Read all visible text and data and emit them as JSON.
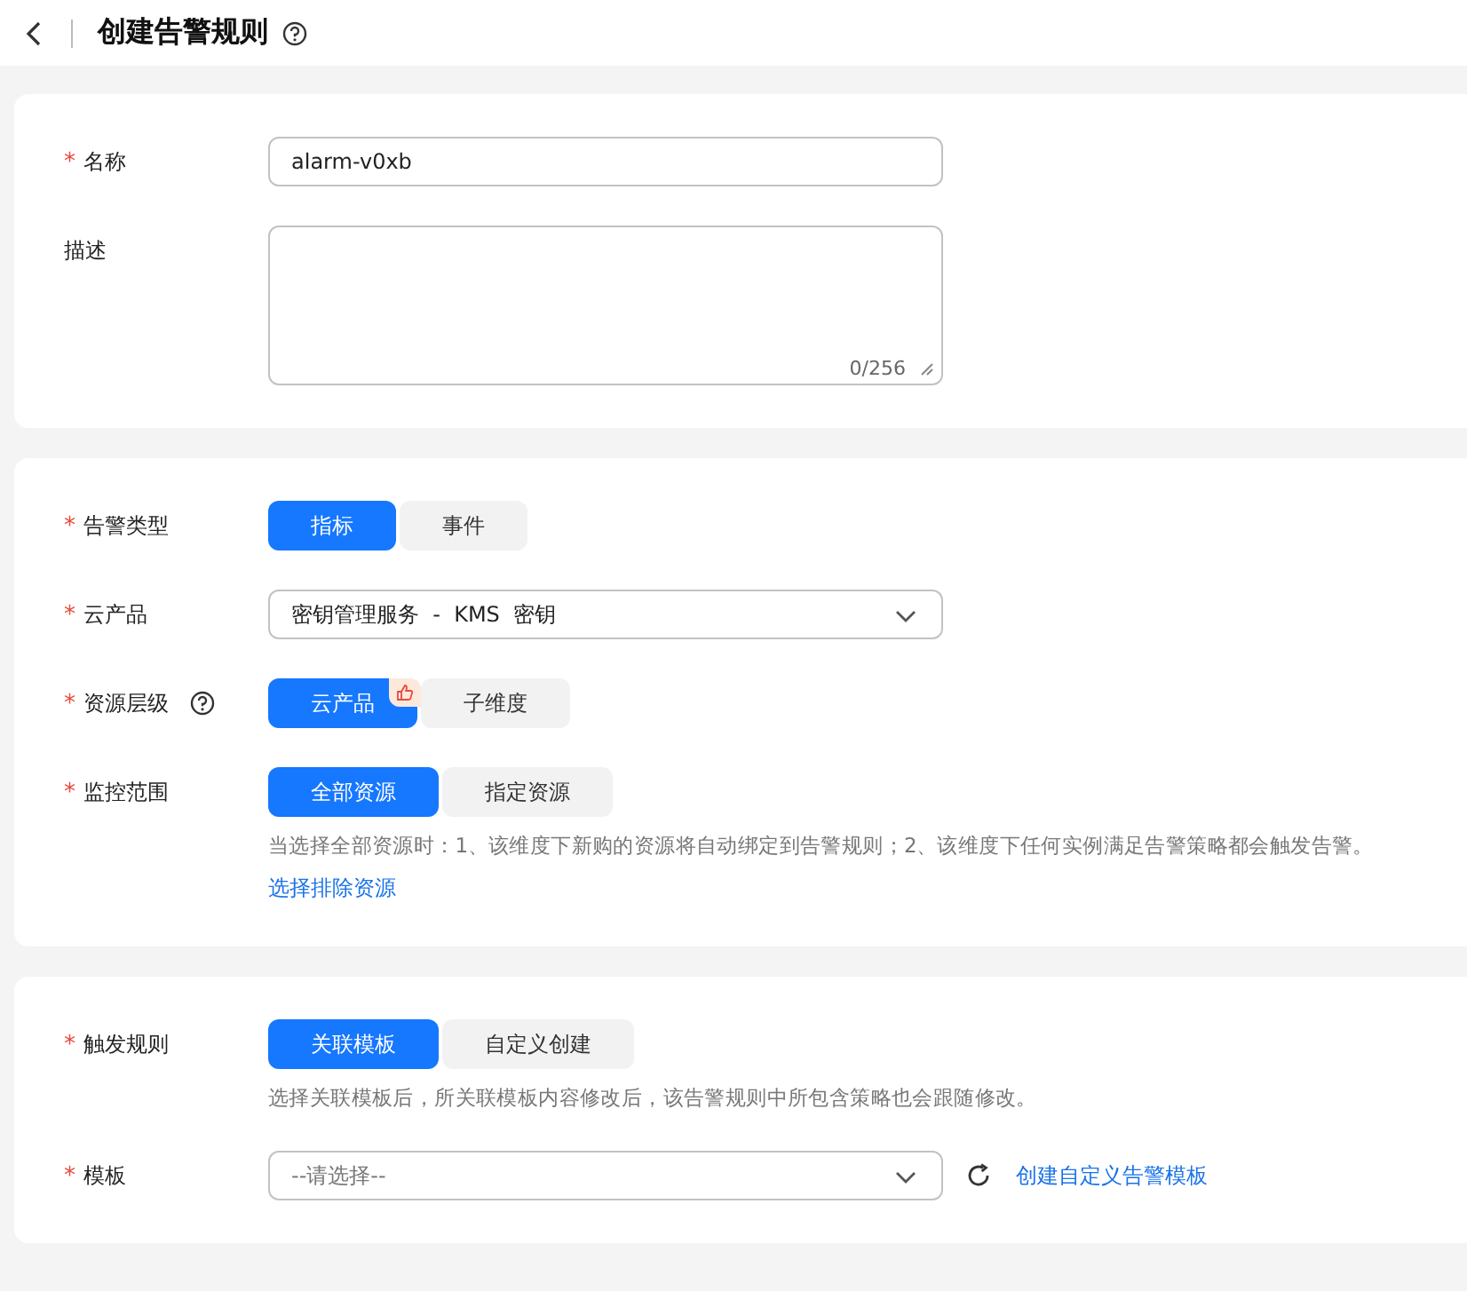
{
  "header": {
    "title": "创建告警规则",
    "help": true
  },
  "sections": [
    {
      "fields": [
        {
          "kind": "text",
          "label": "名称",
          "required_mark": "*",
          "value": "alarm-v0xb"
        },
        {
          "kind": "textarea",
          "label": "描述",
          "counter": "0/256"
        }
      ]
    },
    {
      "fields": [
        {
          "kind": "segmented",
          "label": "告警类型",
          "required_mark": "*",
          "options": [
            {
              "label": "指标",
              "selected": true
            },
            {
              "label": "事件",
              "selected": false
            }
          ]
        },
        {
          "kind": "select",
          "label": "云产品",
          "required_mark": "*",
          "value": "密钥管理服务  -  KMS  密钥"
        },
        {
          "kind": "segmented",
          "label": "资源层级",
          "required_mark": "*",
          "help": true,
          "options": [
            {
              "label": "云产品",
              "selected": true,
              "badge": true
            },
            {
              "label": "子维度",
              "selected": false
            }
          ]
        },
        {
          "kind": "segmented",
          "label": "监控范围",
          "required_mark": "*",
          "options": [
            {
              "label": "全部资源",
              "selected": true
            },
            {
              "label": "指定资源",
              "selected": false
            }
          ],
          "hint": "当选择全部资源时：1、该维度下新购的资源将自动绑定到告警规则；2、该维度下任何实例满足告警策略都会触发告警。",
          "link": "选择排除资源"
        }
      ]
    },
    {
      "fields": [
        {
          "kind": "segmented",
          "label": "触发规则",
          "required_mark": "*",
          "options": [
            {
              "label": "关联模板",
              "selected": true
            },
            {
              "label": "自定义创建",
              "selected": false
            }
          ],
          "hint": "选择关联模板后，所关联模板内容修改后，该告警规则中所包含策略也会跟随修改。"
        },
        {
          "kind": "select",
          "label": "模板",
          "required_mark": "*",
          "placeholder": "--请选择--",
          "refresh": true,
          "link": "创建自定义告警模板"
        }
      ]
    }
  ]
}
